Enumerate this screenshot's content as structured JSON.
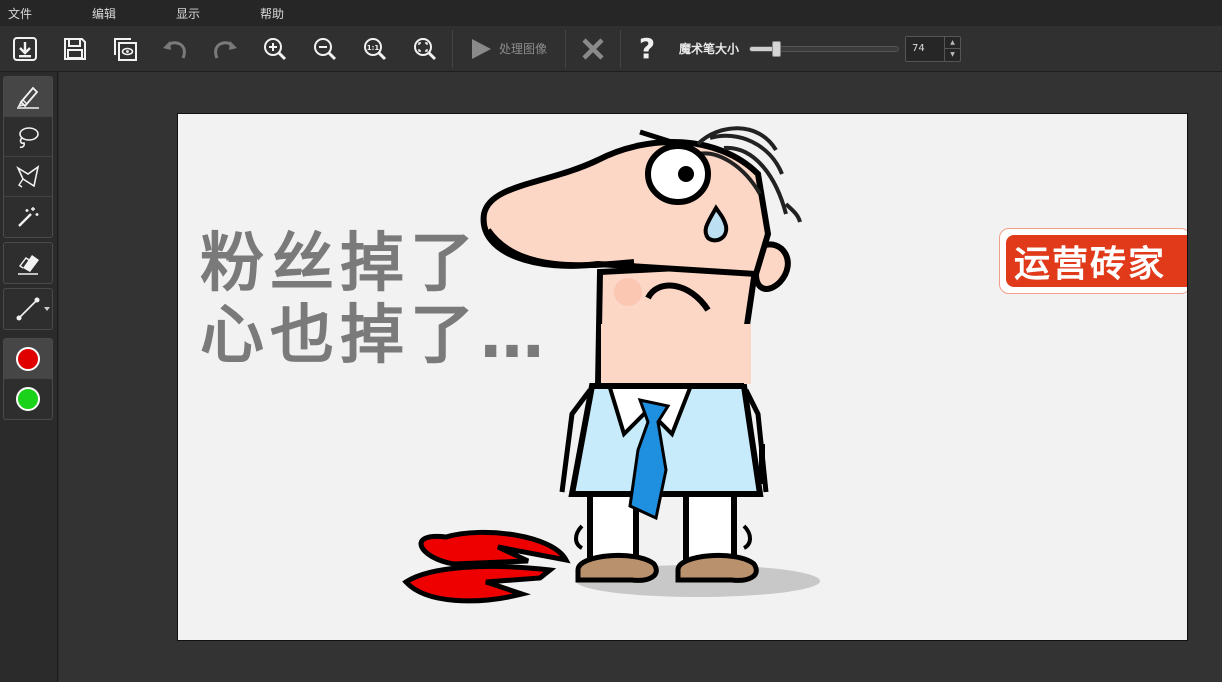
{
  "menu": {
    "items": [
      {
        "label": "文件"
      },
      {
        "label": "编辑"
      },
      {
        "label": "显示"
      },
      {
        "label": "帮助"
      }
    ]
  },
  "toolbar": {
    "buttons": [
      {
        "icon": "import-icon"
      },
      {
        "icon": "save-icon"
      },
      {
        "icon": "preview-icon"
      },
      {
        "icon": "undo-icon"
      },
      {
        "icon": "redo-icon"
      },
      {
        "icon": "zoom-in-icon"
      },
      {
        "icon": "zoom-out-icon"
      },
      {
        "icon": "zoom-actual-icon"
      },
      {
        "icon": "zoom-fit-icon"
      }
    ],
    "process_label": "处理图像",
    "clear_icon": "close-x-icon",
    "help_label": "?",
    "brush_size_label": "魔术笔大小",
    "brush_size_value": "74",
    "brush_size_fraction": 0.16,
    "zoom_actual_text": "1:1"
  },
  "tools": {
    "selection": [
      {
        "icon": "marker-pen-icon",
        "active": true
      },
      {
        "icon": "lasso-icon"
      },
      {
        "icon": "polygon-lasso-icon"
      },
      {
        "icon": "magic-wand-icon"
      }
    ],
    "eraser": {
      "icon": "eraser-icon"
    },
    "line": {
      "icon": "line-tool-icon"
    },
    "colors": [
      {
        "name": "red",
        "hex": "#e00000"
      },
      {
        "name": "green",
        "hex": "#19d219"
      }
    ]
  },
  "image": {
    "caption_line1": "粉丝掉了",
    "caption_line2": "心也掉了…",
    "watermark": "运营砖家"
  },
  "colors": {
    "background": "#2b2b2b",
    "canvas": "#f2f2f2",
    "logo_red": "#e03a1a"
  }
}
